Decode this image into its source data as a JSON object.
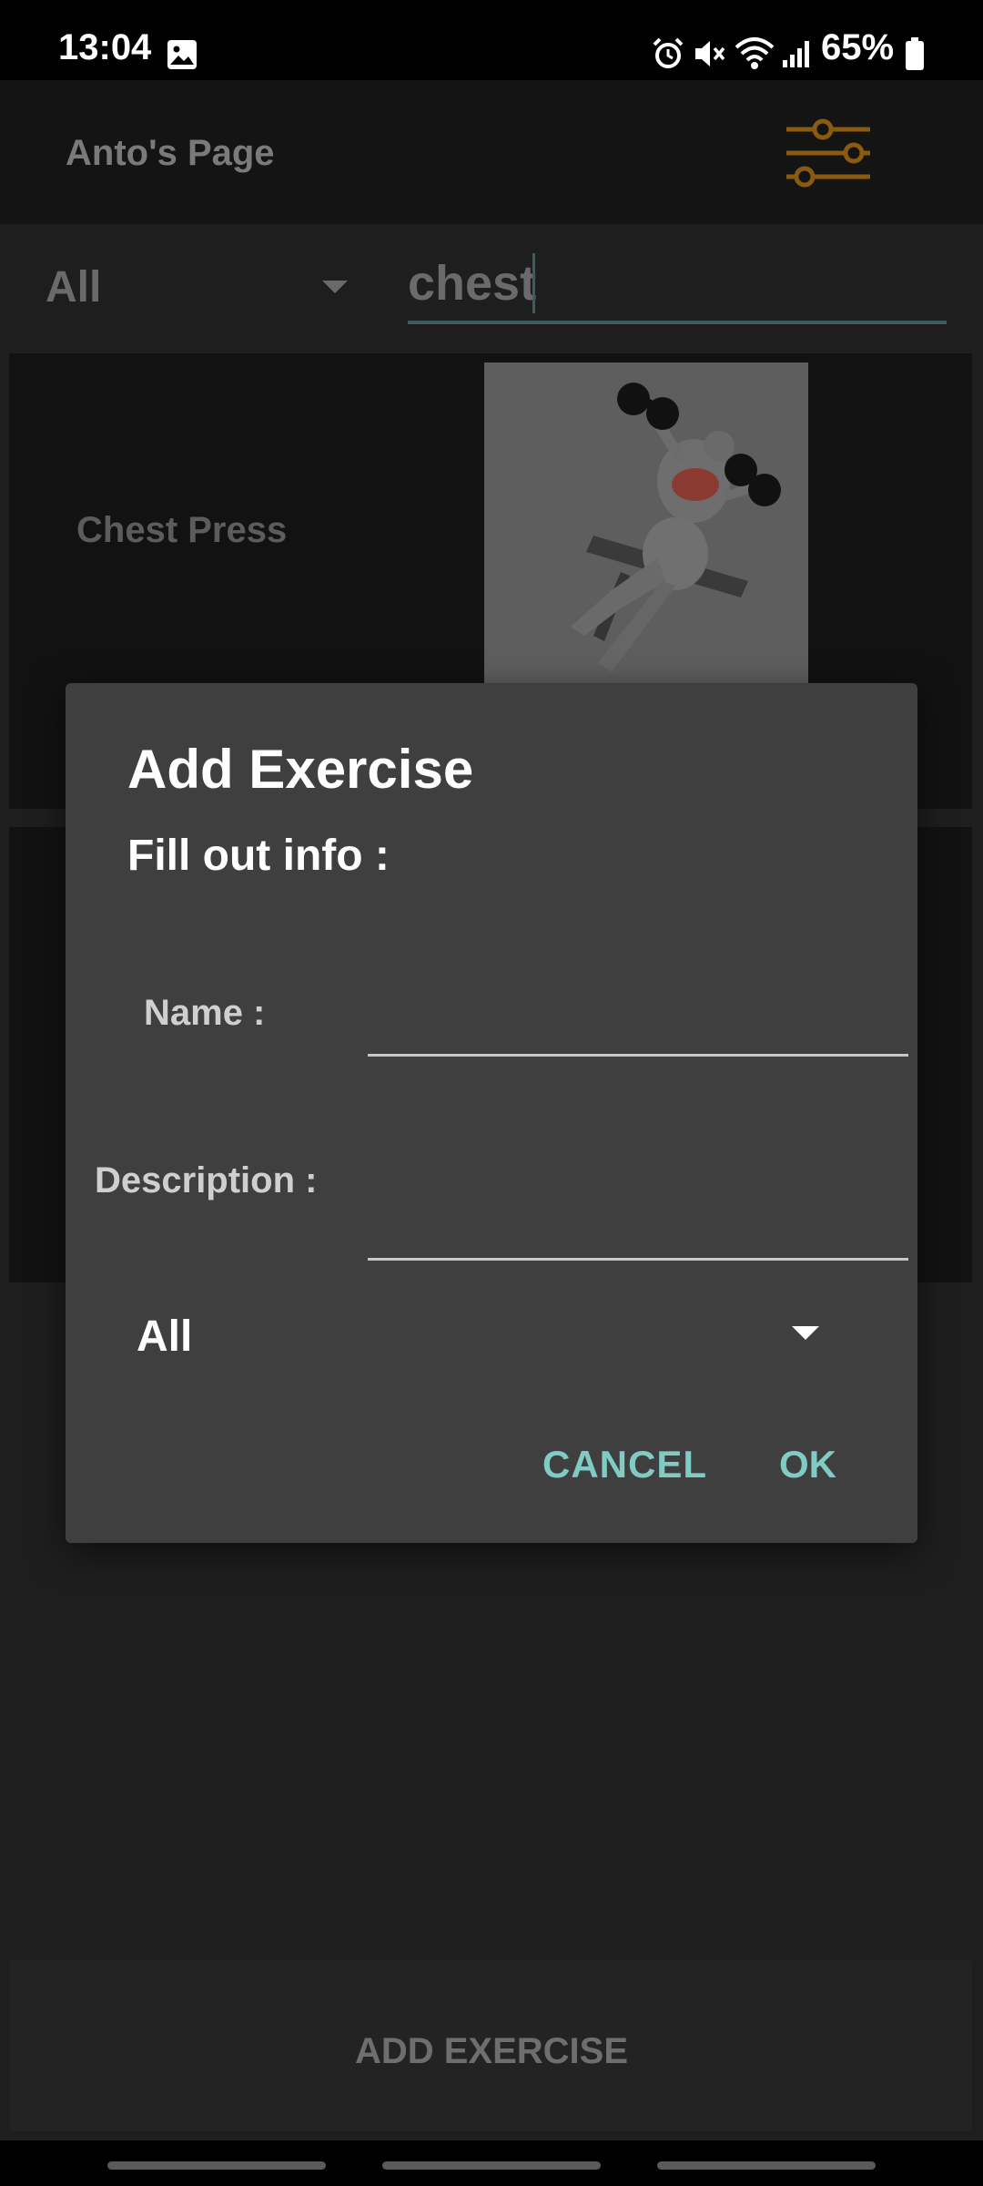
{
  "status_bar": {
    "time": "13:04",
    "battery": "65%",
    "icons": [
      "image-icon",
      "alarm-icon",
      "mute-icon",
      "wifi-icon",
      "signal-icon",
      "battery-icon"
    ]
  },
  "header": {
    "title": "Anto's Page",
    "filter_icon": "sliders-icon",
    "accent_color": "#8a5a10"
  },
  "filters": {
    "category": "All",
    "search_value": "chest"
  },
  "exercises": [
    {
      "title": "Chest Press",
      "image": "dumbbell-press-illustration"
    }
  ],
  "dialog": {
    "title": "Add Exercise",
    "subtitle": "Fill out info :",
    "name_label": "Name :",
    "name_value": "",
    "description_label": "Description :",
    "description_value": "",
    "category": "All",
    "cancel_label": "CANCEL",
    "ok_label": "OK",
    "button_color": "#80cbc4"
  },
  "footer": {
    "add_button_label": "ADD EXERCISE"
  }
}
